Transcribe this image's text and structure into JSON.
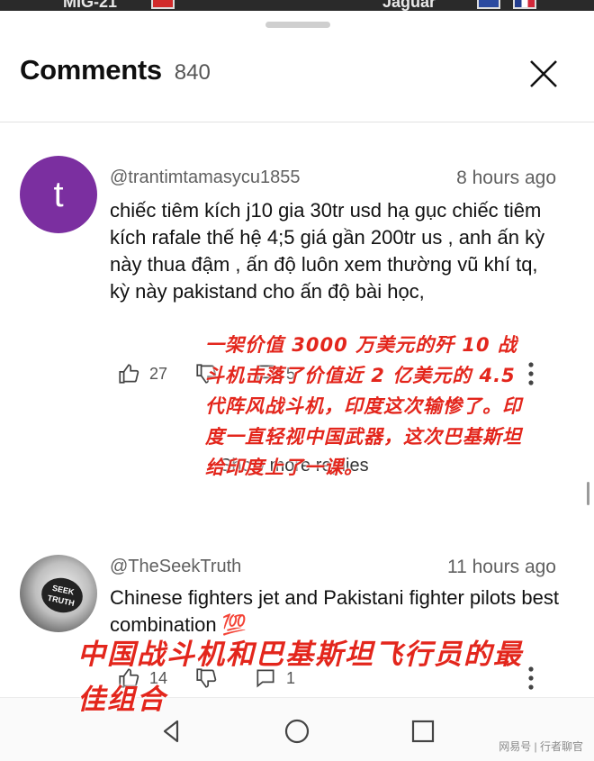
{
  "top_strip": {
    "left_text": "MIG-21",
    "right_text": "Jaguar"
  },
  "header": {
    "title": "Comments",
    "count": "840"
  },
  "comments": [
    {
      "avatar_letter": "t",
      "handle": "@trantimtamasycu1855",
      "time": "8 hours ago",
      "text": "chiếc tiêm kích j10 gia 30tr usd hạ gục chiếc tiêm kích rafale thế hệ  4;5 giá gần 200tr us , anh ấn kỳ này thua đậm  , ấn độ luôn xem thường vũ khí tq, kỳ này pakistand cho ấn độ bài học,",
      "likes": "27",
      "replies": "5",
      "show_more": "Show more replies"
    },
    {
      "avatar_text": "SEEK TRUTH",
      "handle": "@TheSeekTruth",
      "time": "11 hours ago",
      "text": "Chinese fighters jet and Pakistani fighter pilots best combination 💯",
      "likes": "14",
      "replies": "1"
    }
  ],
  "overlays": {
    "translation_1": "一架价值  3000  万美元的歼  10  战斗机击落了价值近  2  亿美元的  4.5  代阵风战斗机，印度这次输惨了。印度一直轻视中国武器，这次巴基斯坦给印度上了一课。",
    "translation_2": "中国战斗机和巴基斯坦飞行员的最佳组合"
  },
  "watermark": "网易号 | 行者聊官",
  "colors": {
    "avatar_t": "#7b2fa0",
    "overlay_red": "#e3261c",
    "text_primary": "#0f0f0f",
    "text_secondary": "#606060"
  },
  "icons": [
    "close-icon",
    "like-icon",
    "dislike-icon",
    "reply-icon",
    "more-vert-icon",
    "back-icon",
    "home-icon",
    "recents-icon"
  ]
}
